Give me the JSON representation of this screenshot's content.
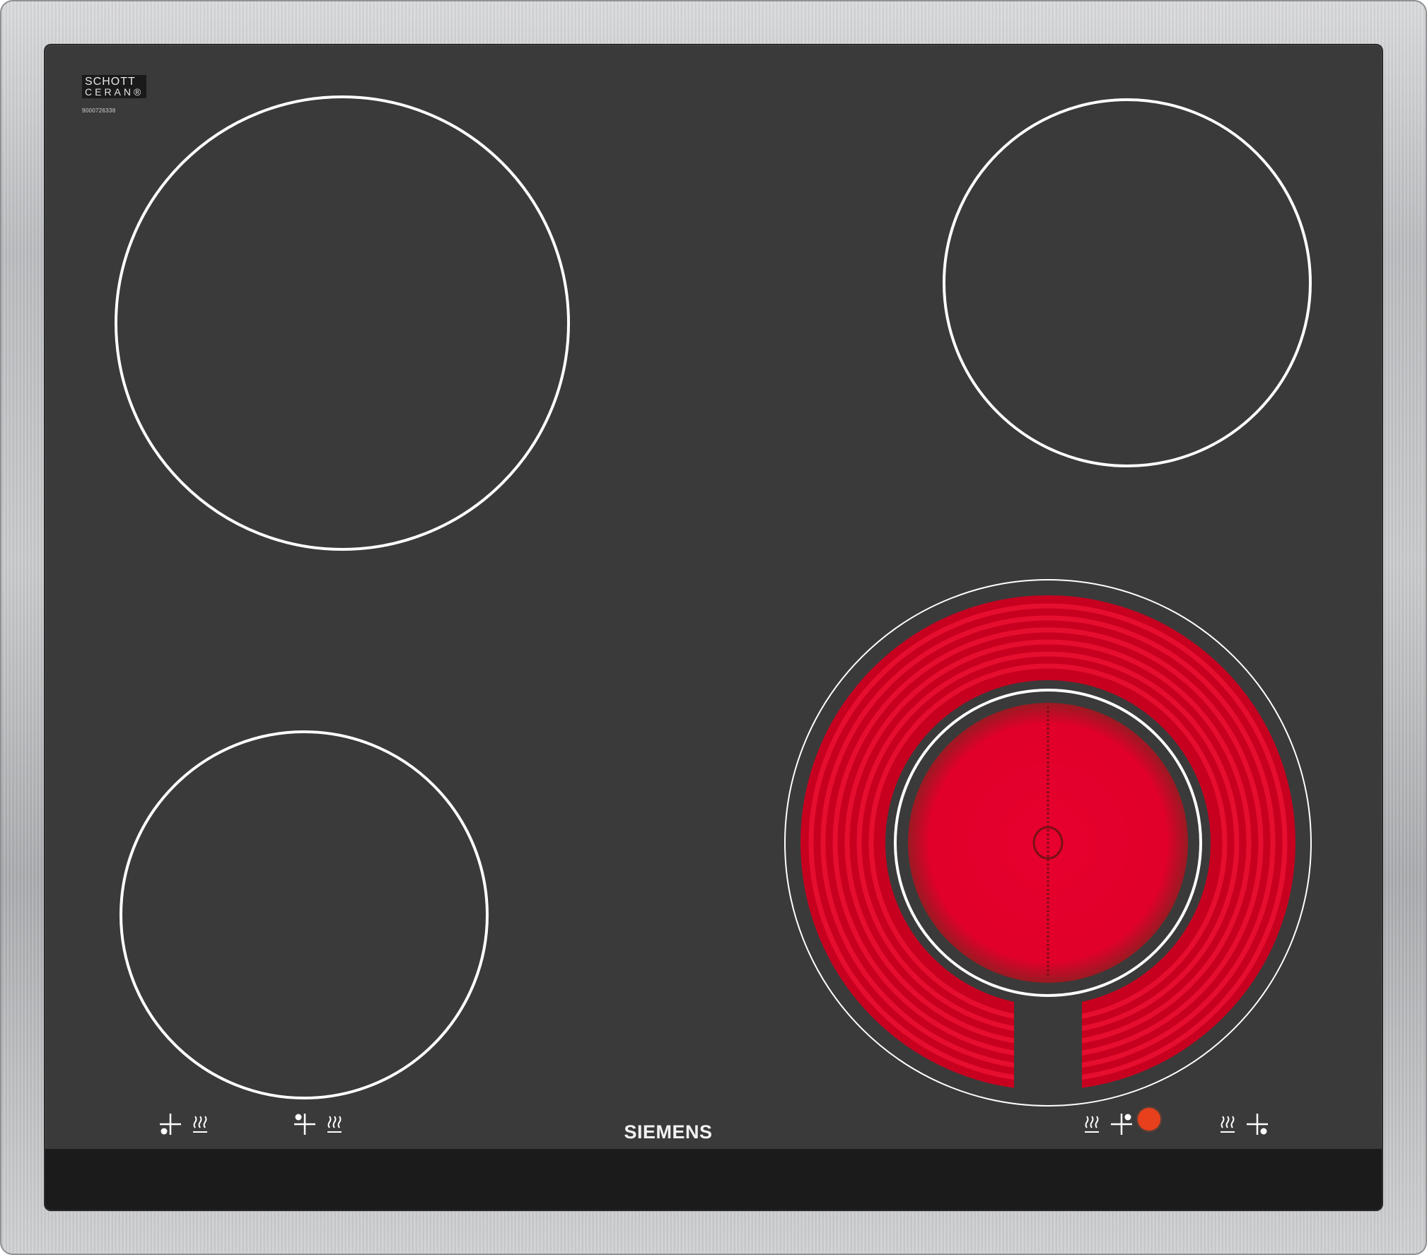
{
  "appliance": {
    "brand": "SIEMENS",
    "glass_maker_line1": "SCHOTT",
    "glass_maker_line2": "CERAN®",
    "serial_number": "9000726338"
  },
  "zones": [
    {
      "name": "front-left",
      "state": "off"
    },
    {
      "name": "back-left",
      "state": "off"
    },
    {
      "name": "back-right",
      "state": "off"
    },
    {
      "name": "front-right-dual",
      "state": "on",
      "inner_ring": "on",
      "outer_ring": "on"
    }
  ],
  "controls": [
    {
      "name": "zone-selector-1",
      "icon": "zone-position-icon",
      "heat_icon": "heat-waves-icon"
    },
    {
      "name": "zone-selector-2",
      "icon": "zone-position-icon",
      "heat_icon": "heat-waves-icon"
    },
    {
      "name": "zone-selector-3",
      "icon": "zone-position-icon",
      "heat_icon": "heat-waves-icon"
    },
    {
      "name": "zone-selector-4",
      "icon": "zone-position-icon",
      "heat_icon": "heat-waves-icon"
    }
  ],
  "indicator": {
    "state": "on",
    "color": "#e8401c"
  },
  "colors": {
    "glass": "#3a3a3a",
    "ring": "#ffffff",
    "heating_element": "#e0002a",
    "control_strip": "#1b1b1b",
    "frame": "#c0c2c4"
  }
}
